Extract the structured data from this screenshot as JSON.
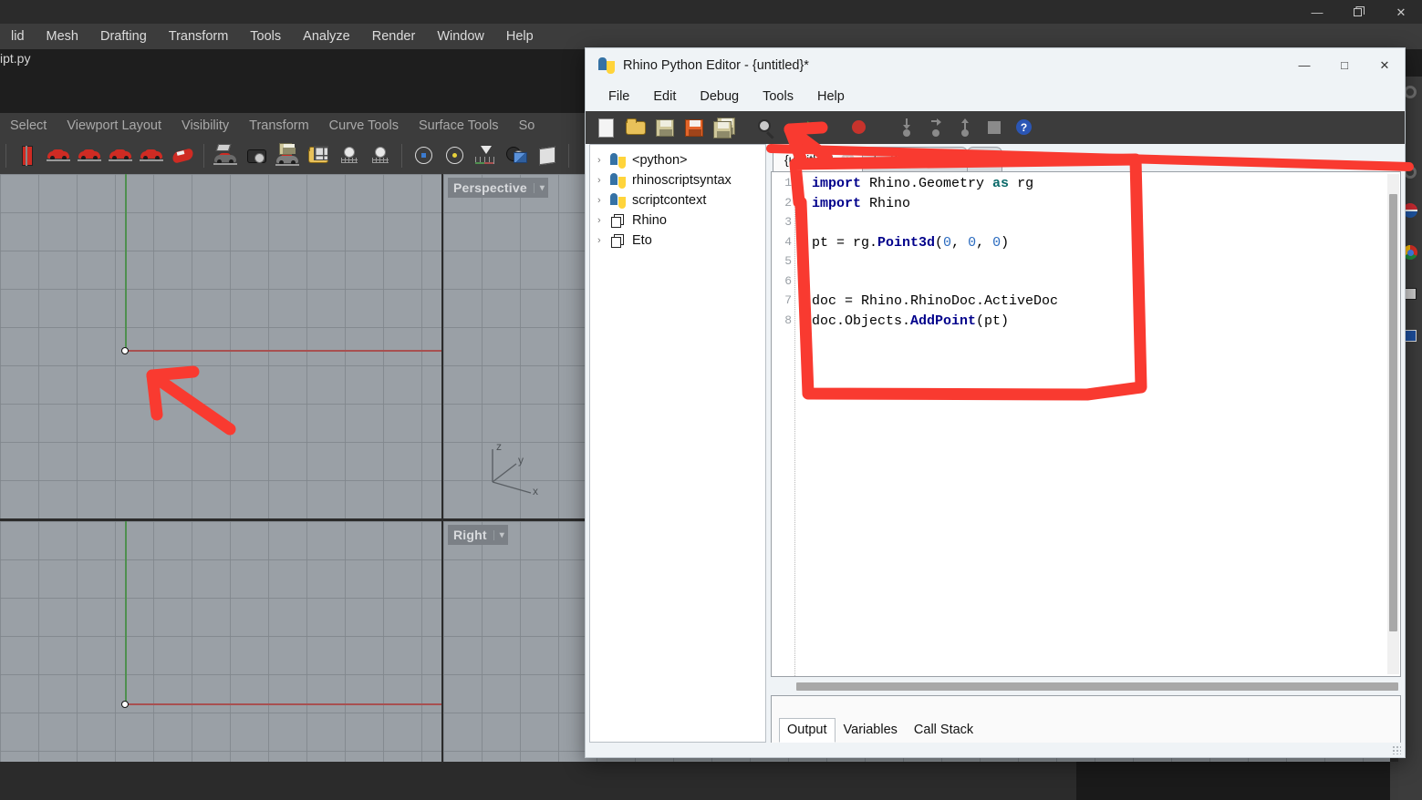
{
  "rhino": {
    "titlebar": {
      "minimize": "—",
      "restore": "❐",
      "close": "✕"
    },
    "menus": [
      "lid",
      "Mesh",
      "Drafting",
      "Transform",
      "Tools",
      "Analyze",
      "Render",
      "Window",
      "Help"
    ],
    "command_line": "ipt.py",
    "tabs": [
      "Select",
      "Viewport Layout",
      "Visibility",
      "Transform",
      "Curve Tools",
      "Surface Tools",
      "So"
    ],
    "viewports": [
      {
        "label": "Perspective",
        "chevron": "▾"
      },
      {
        "label": "Right",
        "chevron": "▾"
      }
    ],
    "gizmo_axes": [
      "z",
      "y",
      "x"
    ]
  },
  "editor": {
    "window_title": "Rhino Python Editor - {untitled}*",
    "title_icon": "python-logo-icon",
    "window_buttons": {
      "minimize": "—",
      "maximize": "□",
      "close": "✕"
    },
    "menus": [
      "File",
      "Edit",
      "Debug",
      "Tools",
      "Help"
    ],
    "toolbar": [
      {
        "name": "new-file-icon",
        "title": "New"
      },
      {
        "name": "open-file-icon",
        "title": "Open"
      },
      {
        "name": "save-icon",
        "title": "Save"
      },
      {
        "name": "save-as-icon",
        "title": "Save As"
      },
      {
        "name": "save-all-icon",
        "title": "Save All"
      },
      {
        "name": "search-icon",
        "title": "Search"
      },
      {
        "name": "run-icon",
        "title": "Run Script"
      },
      {
        "name": "record-icon",
        "title": "Record"
      },
      {
        "name": "step-into-icon",
        "title": "Step Into"
      },
      {
        "name": "step-over-icon",
        "title": "Step Over"
      },
      {
        "name": "step-out-icon",
        "title": "Step Out"
      },
      {
        "name": "stop-icon",
        "title": "Stop"
      },
      {
        "name": "help-icon",
        "title": "Help"
      }
    ],
    "tree": [
      {
        "label": "<python>",
        "icon": "python-module-icon",
        "chevron": "›"
      },
      {
        "label": "rhinoscriptsyntax",
        "icon": "python-module-icon",
        "chevron": "›"
      },
      {
        "label": "scriptcontext",
        "icon": "python-module-icon",
        "chevron": "›"
      },
      {
        "label": "Rhino",
        "icon": "assembly-icon",
        "chevron": "›"
      },
      {
        "label": "Eto",
        "icon": "assembly-icon",
        "chevron": "›"
      }
    ],
    "tabs": [
      {
        "label": "{untitled}",
        "active": true,
        "close": "✕"
      },
      {
        "label": "test0003.py",
        "active": false,
        "close": "✕"
      },
      {
        "label": "",
        "active": false,
        "blank": true
      }
    ],
    "code_lines": [
      {
        "n": "1",
        "text": "import Rhino.Geometry as rg"
      },
      {
        "n": "2",
        "text": "import Rhino"
      },
      {
        "n": "3",
        "text": ""
      },
      {
        "n": "4",
        "text": "pt = rg.Point3d(0, 0, 0)"
      },
      {
        "n": "5",
        "text": ""
      },
      {
        "n": "6",
        "text": ""
      },
      {
        "n": "7",
        "text": "doc = Rhino.RhinoDoc.ActiveDoc"
      },
      {
        "n": "8",
        "text": "doc.Objects.AddPoint(pt)"
      }
    ],
    "bottom_tabs": [
      {
        "label": "Output",
        "active": true
      },
      {
        "label": "Variables",
        "active": false
      },
      {
        "label": "Call Stack",
        "active": false
      }
    ]
  },
  "colors": {
    "annotation_red": "#f93a30",
    "run_green": "#2fa43a",
    "record_red": "#c7332c",
    "keyword_blue": "#00008B",
    "as_teal": "#0b6a6a",
    "number_blue": "#2b6bbf",
    "viewport_gray": "#9aa0a6",
    "axis_red": "#a85050",
    "axis_green": "#4f8f4f"
  }
}
